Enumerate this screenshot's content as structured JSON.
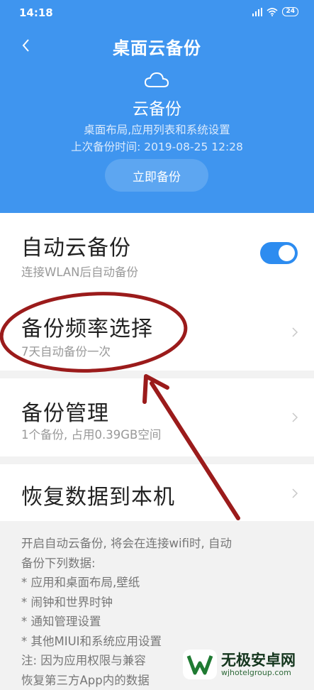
{
  "status_bar": {
    "time": "14:18",
    "battery": "24"
  },
  "header": {
    "title": "桌面云备份",
    "icon": "cloud-icon",
    "subtitle": "云备份",
    "description": "桌面布局,应用列表和系统设置",
    "last_backup": "上次备份时间: 2019-08-25 12:28",
    "backup_now_label": "立即备份",
    "color": "#3f95ef"
  },
  "settings": {
    "auto_backup": {
      "title": "自动云备份",
      "subtitle": "连接WLAN后自动备份",
      "enabled": true
    },
    "frequency": {
      "title": "备份频率选择",
      "subtitle": "7天自动备份一次"
    },
    "manage": {
      "title": "备份管理",
      "subtitle": "1个备份, 占用0.39GB空间"
    },
    "restore": {
      "title": "恢复数据到本机"
    }
  },
  "notes": {
    "line1": "开启自动云备份, 将会在连接wifi时, 自动",
    "line2": "备份下列数据:",
    "line3": "*  应用和桌面布局,壁纸",
    "line4": "*  闹钟和世界时钟",
    "line5": "*  通知管理设置",
    "line6": "*  其他MIUI和系统应用设置",
    "line7": "注: 因为应用权限与兼容",
    "line8": "恢复第三方App内的数据"
  },
  "watermark": {
    "name": "无极安卓网",
    "url": "wjhotelgroup.com"
  },
  "annotation_color": "#9b1b1b"
}
